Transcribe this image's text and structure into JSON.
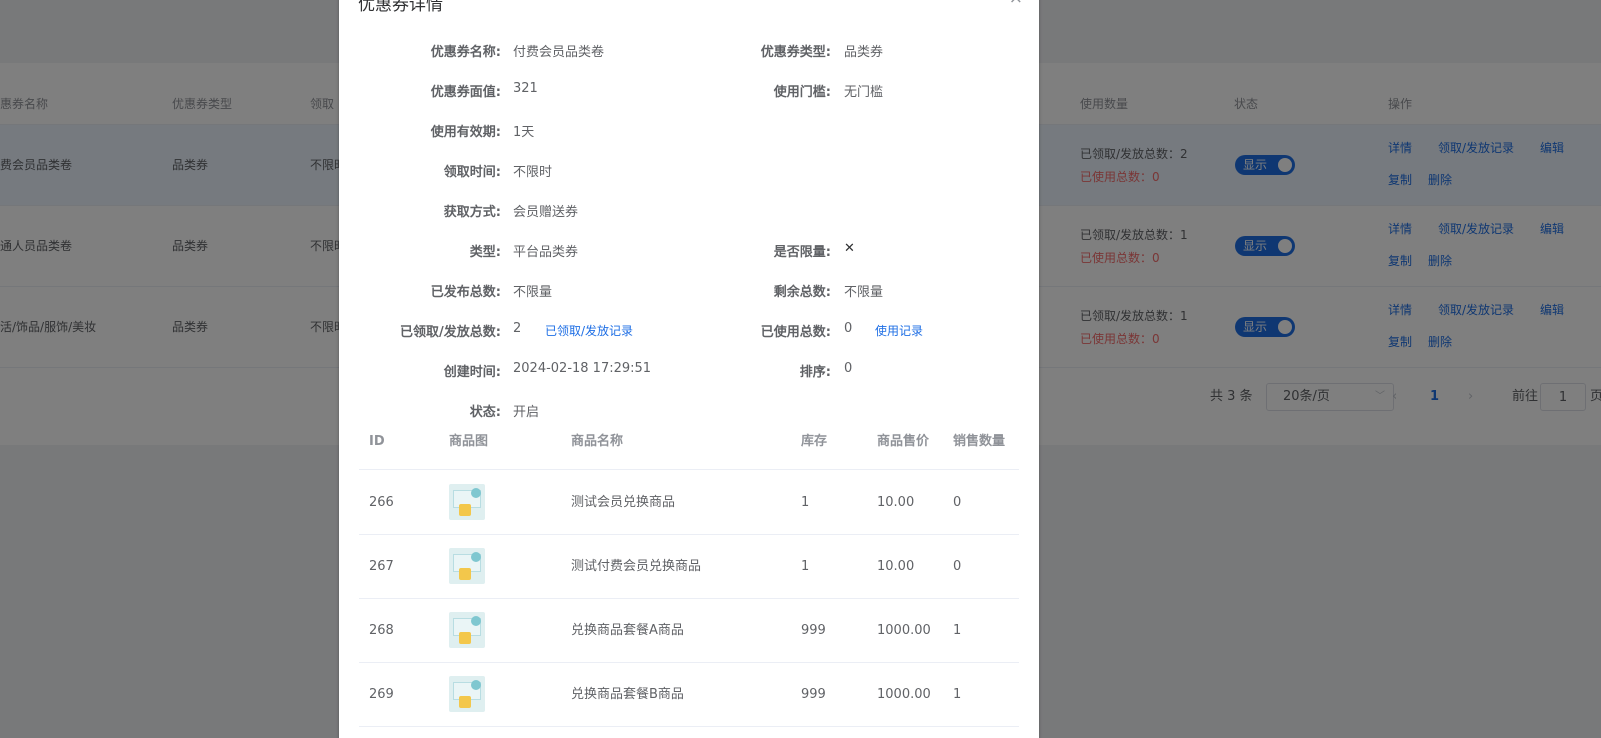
{
  "background": {
    "headers": [
      "惠券名称",
      "优惠券类型",
      "领取",
      "使用数量",
      "状态",
      "操作"
    ],
    "rows": [
      {
        "name": "费会员品类卷",
        "type": "品类券",
        "claim": "不限时",
        "claimed": "已领取/发放总数：2",
        "used": "已使用总数：0",
        "status": "显示",
        "ops": [
          "详情",
          "领取/发放记录",
          "编辑",
          "复制",
          "删除"
        ]
      },
      {
        "name": "通人员品类卷",
        "type": "品类券",
        "claim": "不限时",
        "claimed": "已领取/发放总数：1",
        "used": "已使用总数：0",
        "status": "显示",
        "ops": [
          "详情",
          "领取/发放记录",
          "编辑",
          "复制",
          "删除"
        ]
      },
      {
        "name": "活/饰品/服饰/美妆",
        "type": "品类券",
        "claim": "不限时",
        "claimed": "已领取/发放总数：1",
        "used": "已使用总数：0",
        "status": "显示",
        "ops": [
          "详情",
          "领取/发放记录",
          "编辑",
          "复制",
          "删除"
        ]
      }
    ],
    "pagination": {
      "total": "共 3 条",
      "page_size": "20条/页",
      "prev": "‹",
      "current": "1",
      "next": "›",
      "goto": "前往",
      "goto_value": "1",
      "page_suffix": "页"
    }
  },
  "dialog": {
    "title": "优惠券详情",
    "close": "×",
    "info": {
      "name_label": "优惠券名称:",
      "name_value": "付费会员品类卷",
      "type_label": "优惠券类型:",
      "type_value": "品类券",
      "face_label": "优惠券面值:",
      "face_value": "321",
      "threshold_label": "使用门槛:",
      "threshold_value": "无门槛",
      "validity_label": "使用有效期:",
      "validity_value": "1天",
      "claim_time_label": "领取时间:",
      "claim_time_value": "不限时",
      "method_label": "获取方式:",
      "method_value": "会员赠送券",
      "kind_label": "类型:",
      "kind_value": "平台品类券",
      "limit_label": "是否限量:",
      "limit_value": "✕",
      "published_label": "已发布总数:",
      "published_value": "不限量",
      "remaining_label": "剩余总数:",
      "remaining_value": "不限量",
      "claimed_label": "已领取/发放总数:",
      "claimed_value": "2",
      "claimed_link": "已领取/发放记录",
      "used_label": "已使用总数:",
      "used_value": "0",
      "used_link": "使用记录",
      "created_label": "创建时间:",
      "created_value": "2024-02-18 17:29:51",
      "sort_label": "排序:",
      "sort_value": "0",
      "status_label": "状态:",
      "status_value": "开启"
    },
    "products": {
      "headers": [
        "ID",
        "商品图",
        "商品名称",
        "库存",
        "商品售价",
        "销售数量"
      ],
      "rows": [
        {
          "id": "266",
          "name": "测试会员兑换商品",
          "stock": "1",
          "price": "10.00",
          "sales": "0"
        },
        {
          "id": "267",
          "name": "测试付费会员兑换商品",
          "stock": "1",
          "price": "10.00",
          "sales": "0"
        },
        {
          "id": "268",
          "name": "兑换商品套餐A商品",
          "stock": "999",
          "price": "1000.00",
          "sales": "1"
        },
        {
          "id": "269",
          "name": "兑换商品套餐B商品",
          "stock": "999",
          "price": "1000.00",
          "sales": "1"
        }
      ]
    }
  }
}
